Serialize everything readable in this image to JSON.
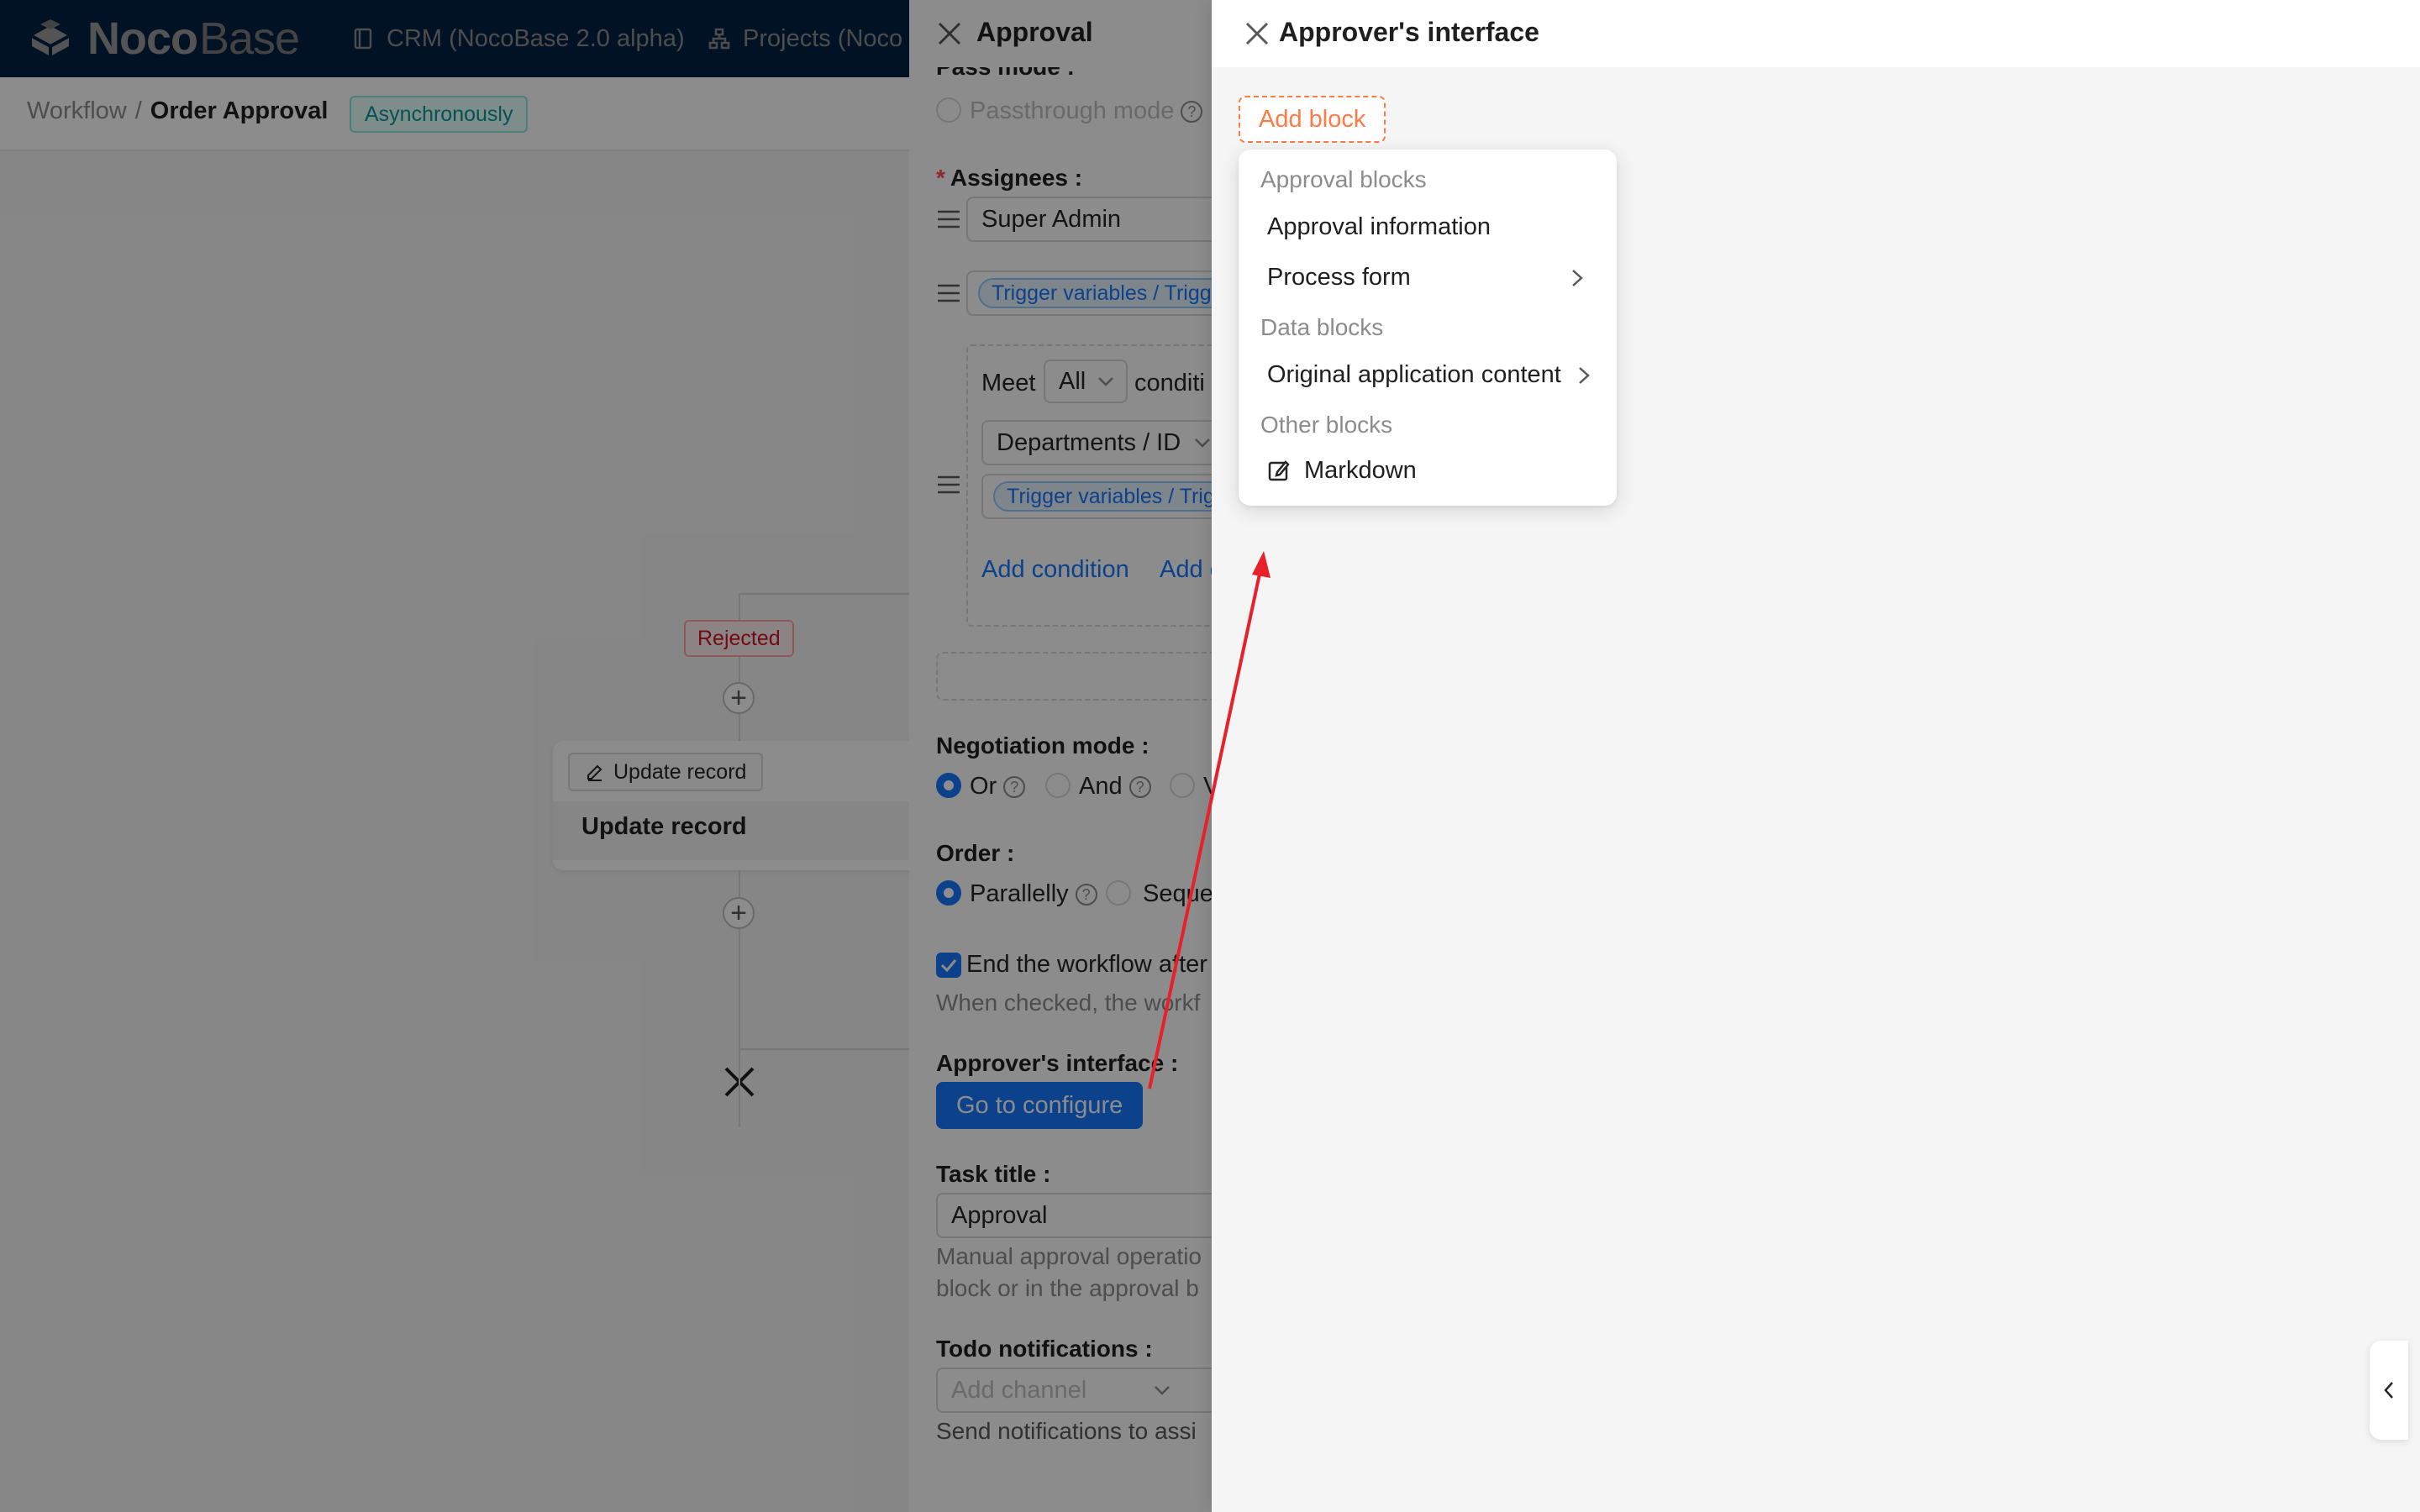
{
  "app": {
    "brand_bold": "Noco",
    "brand_light": "Base",
    "nav": [
      {
        "label": "CRM (NocoBase 2.0 alpha)",
        "icon": "book-icon"
      },
      {
        "label": "Projects (Noco",
        "icon": "sitemap-icon"
      }
    ]
  },
  "breadcrumb": {
    "parent": "Workflow",
    "separator": "/",
    "current": "Order Approval",
    "tag": "Asynchronously"
  },
  "canvas": {
    "rejected_label": "Rejected",
    "node_chip": "Update record",
    "node_title": "Update record"
  },
  "approval_drawer": {
    "title": "Approval",
    "pass_mode_label": "Pass mode :",
    "passthrough_option": "Passthrough mode",
    "assignees_label": "Assignees :",
    "assignee_1": "Super Admin",
    "assignee_2_chip": "Trigger variables / Trigg",
    "meet_label": "Meet",
    "meet_value": "All",
    "conditions_label": "conditi",
    "condition_field": "Departments / ID",
    "condition_value_chip": "Trigger variables / Trig",
    "add_condition": "Add condition",
    "add_group": "Add c",
    "negotiation_label": "Negotiation mode :",
    "negotiation_options": [
      "Or",
      "And",
      "V"
    ],
    "order_label": "Order :",
    "order_options": [
      "Parallelly",
      "Seque"
    ],
    "end_workflow_label": "End the workflow after",
    "end_workflow_desc": "When checked, the workf",
    "approver_interface_label": "Approver's interface :",
    "configure_button": "Go to configure",
    "task_title_label": "Task title :",
    "task_title_value": "Approval",
    "task_title_desc_1": "Manual approval operatio",
    "task_title_desc_2": "block or in the approval b",
    "todo_label": "Todo notifications :",
    "todo_placeholder": "Add channel",
    "todo_desc": "Send notifications to assi"
  },
  "approver_drawer": {
    "title": "Approver's interface",
    "add_block": "Add block",
    "menu": {
      "groups": [
        {
          "title": "Approval blocks",
          "items": [
            {
              "label": "Approval information",
              "submenu": false
            },
            {
              "label": "Process form",
              "submenu": true
            }
          ]
        },
        {
          "title": "Data blocks",
          "items": [
            {
              "label": "Original application content",
              "submenu": true
            }
          ]
        },
        {
          "title": "Other blocks",
          "items": [
            {
              "label": "Markdown",
              "submenu": false,
              "icon": "edit-icon"
            }
          ]
        }
      ]
    }
  },
  "colors": {
    "topbar": "#002140",
    "primary": "#1677ff",
    "add_block_accent": "#ff7a45",
    "annotation_arrow": "#e8202a"
  }
}
